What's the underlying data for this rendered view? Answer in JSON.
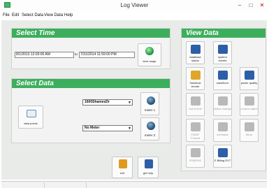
{
  "window": {
    "title": "Log Viewer",
    "minimize": "–",
    "maximize": "□",
    "close": "✕"
  },
  "menu": [
    "File",
    "Edit",
    "Select Data",
    "View Data",
    "Help"
  ],
  "select_time": {
    "heading": "Select Time",
    "start": "8/1/2013 12:00:00 AM",
    "to_label": "to",
    "end": "7/31/2014 11:59:00 PM",
    "time_range_label": "time range"
  },
  "select_data": {
    "heading": "Select Data",
    "data_points_label": "data points",
    "meter1_select": "1600ShamesDr",
    "meter2_select": "No Meter",
    "meter1_label": "meter 1",
    "meter2_label": "meter 2"
  },
  "actions": {
    "exit_label": "exit",
    "help_label": "get help"
  },
  "view_data": {
    "heading": "View Data",
    "tiles": [
      {
        "label": "database status",
        "enabled": true,
        "color": "#2d5fa8"
      },
      {
        "label": "system events",
        "enabled": true,
        "color": "#2d5fa8"
      },
      {
        "label": "",
        "enabled": false,
        "color": "#ffffff"
      },
      {
        "label": "historical trends",
        "enabled": true,
        "color": "#e0a52b"
      },
      {
        "label": "waveform",
        "enabled": true,
        "color": "#2d5fa8"
      },
      {
        "label": "power quality",
        "enabled": true,
        "color": "#2d5fa8"
      },
      {
        "label": "out of limit",
        "enabled": false,
        "color": "#b9b9b9"
      },
      {
        "label": "status change",
        "enabled": false,
        "color": "#b9b9b9"
      },
      {
        "label": "control output",
        "enabled": false,
        "color": "#b9b9b9"
      },
      {
        "label": "PQDIF Format",
        "enabled": false,
        "color": "#b9b9b9"
      },
      {
        "label": "comtrade",
        "enabled": false,
        "color": "#b9b9b9"
      },
      {
        "label": "iferar",
        "enabled": false,
        "color": "#b9b9b9"
      },
      {
        "label": "EN50160",
        "enabled": false,
        "color": "#b9b9b9"
      },
      {
        "label": "E Billing EXT",
        "enabled": true,
        "color": "#2d5fa8"
      }
    ]
  }
}
